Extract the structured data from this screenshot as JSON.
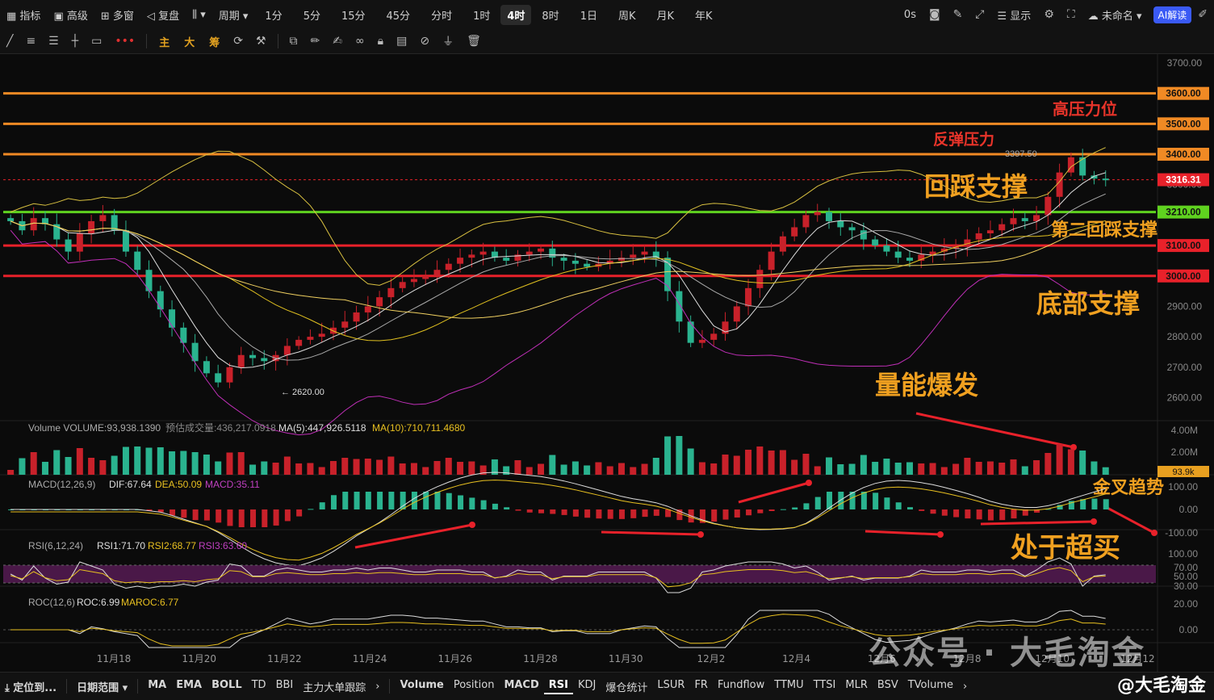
{
  "toolbar": {
    "indicator": "指标",
    "advanced": "高级",
    "multi": "多窗",
    "replay": "复盘",
    "period": "周期",
    "intervals": [
      "1分",
      "5分",
      "15分",
      "45分",
      "分时",
      "1时",
      "4时",
      "8时",
      "1日",
      "周K",
      "月K",
      "年K"
    ],
    "active_interval": "4时",
    "zero_s": "0s",
    "display": "显示",
    "user": "未命名",
    "ai": "AI解读"
  },
  "drawtools": {
    "main": "主",
    "big": "大",
    "chip": "筹"
  },
  "bottom": {
    "locate": "定位到...",
    "date_range": "日期范围",
    "main_indicators": [
      "MA",
      "EMA",
      "BOLL",
      "TD",
      "BBI",
      "主力大单跟踪"
    ],
    "sub_indicators": [
      "Volume",
      "Position",
      "MACD",
      "RSI",
      "KDJ",
      "爆仓统计",
      "LSUR",
      "FR",
      "Fundflow",
      "TTMU",
      "TTSI",
      "MLR",
      "BSV",
      "TVolume"
    ],
    "selected_sub": "RSI"
  },
  "watermark": {
    "text": "公众号 · 大毛淘金",
    "corner": "@大毛淘金"
  },
  "colors": {
    "up": "#c8212a",
    "down": "#2ab38f",
    "orange": "#f08a24",
    "green": "#5fd21f",
    "red": "#e8212a",
    "gold": "#f0c040",
    "magenta": "#c02fb8"
  },
  "chart_data": {
    "type": "candlestick",
    "price_axis": {
      "ylim": [
        2550,
        3750
      ],
      "ticks": [
        "3700.00",
        "3600.00",
        "3500.00",
        "3400.00",
        "3300.00",
        "3200.00",
        "3100.00",
        "3000.00",
        "2900.00",
        "2800.00",
        "2700.00",
        "2600.00"
      ]
    },
    "x_labels": [
      "11月18",
      "11月20",
      "11月22",
      "11月24",
      "11月26",
      "11月28",
      "11月30",
      "12月2",
      "12月4",
      "12月6",
      "12月8",
      "12月10",
      "12月12"
    ],
    "last_price": "3316.31",
    "high_label": "3397.50",
    "low_label": "2620.00",
    "levels": [
      {
        "value": 3600,
        "label": "3600.00",
        "color": "orange"
      },
      {
        "value": 3500,
        "label": "3500.00",
        "color": "orange"
      },
      {
        "value": 3400,
        "label": "3400.00",
        "color": "orange"
      },
      {
        "value": 3210,
        "label": "3210.00",
        "color": "green"
      },
      {
        "value": 3100,
        "label": "3100.00",
        "color": "red"
      },
      {
        "value": 3000,
        "label": "3000.00",
        "color": "red"
      }
    ],
    "annotations": [
      "高压力位",
      "反弹压力",
      "回踩支撑",
      "第二回踩支撑",
      "底部支撑",
      "量能爆发",
      "金叉趋势",
      "处于超买"
    ],
    "closes": [
      3180,
      3150,
      3190,
      3170,
      3120,
      3080,
      3140,
      3180,
      3200,
      3150,
      3080,
      3020,
      2950,
      2890,
      2830,
      2780,
      2720,
      2680,
      2650,
      2700,
      2740,
      2730,
      2720,
      2740,
      2770,
      2790,
      2800,
      2810,
      2830,
      2850,
      2880,
      2900,
      2930,
      2960,
      2980,
      2990,
      3000,
      3020,
      3040,
      3060,
      3070,
      3080,
      3060,
      3050,
      3070,
      3080,
      3090,
      3060,
      3050,
      3040,
      3030,
      3040,
      3050,
      3060,
      3070,
      3080,
      3060,
      2950,
      2850,
      2780,
      2790,
      2810,
      2850,
      2900,
      2960,
      3020,
      3080,
      3130,
      3160,
      3200,
      3210,
      3180,
      3160,
      3150,
      3120,
      3100,
      3080,
      3060,
      3050,
      3070,
      3080,
      3090,
      3100,
      3120,
      3140,
      3150,
      3170,
      3190,
      3180,
      3200,
      3260,
      3340,
      3390,
      3330,
      3320,
      3316.31
    ],
    "volume": {
      "label": "Volume",
      "volume": "VOLUME:93,938.1390",
      "est": "预估成交量:436,217.0918",
      "ma5": "MA(5):447,926.5118",
      "ma10": "MA(10):710,711.4680",
      "ticks": [
        "4.00M",
        "2.00M"
      ],
      "last": "93.9k"
    },
    "macd": {
      "label": "MACD(12,26,9)",
      "dif": "DIF:67.64",
      "dea": "DEA:50.09",
      "macd": "MACD:35.11",
      "ticks": [
        "100.00",
        "0.00",
        "-100.00"
      ]
    },
    "rsi": {
      "label": "RSI(6,12,24)",
      "rsi1": "RSI1:71.70",
      "rsi2": "RSI2:68.77",
      "rsi3": "RSI3:63.60",
      "ticks": [
        "100.00",
        "70.00",
        "50.00",
        "30.00"
      ]
    },
    "roc": {
      "label": "ROC(12,6)",
      "roc": "ROC:6.99",
      "maroc": "MAROC:6.77",
      "ticks": [
        "20.00",
        "0.00"
      ]
    }
  }
}
